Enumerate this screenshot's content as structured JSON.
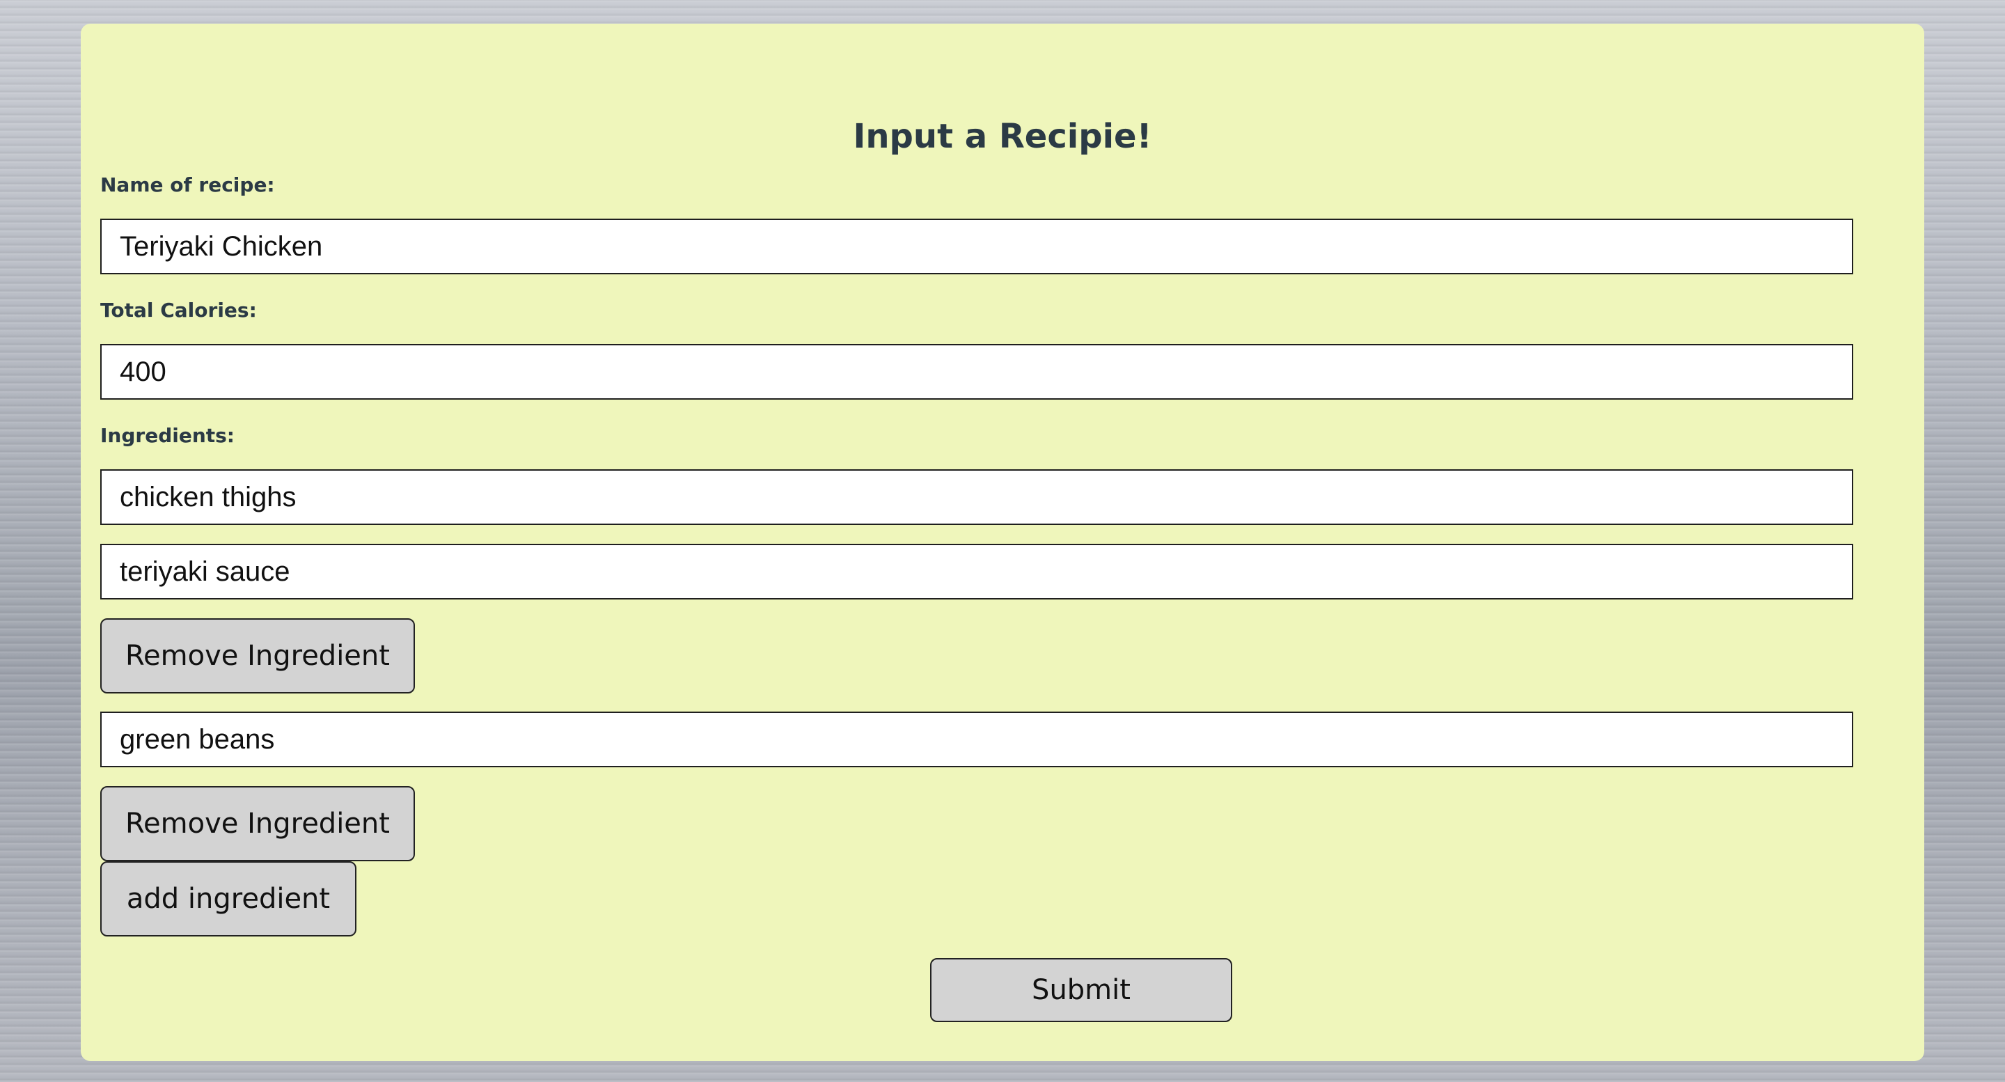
{
  "form": {
    "title": "Input a Recipie!",
    "name_label": "Name of recipe:",
    "name_value": "Teriyaki Chicken",
    "calories_label": "Total Calories:",
    "calories_value": "400",
    "ingredients_label": "Ingredients:",
    "ingredients": [
      {
        "value": "chicken thighs"
      },
      {
        "value": "teriyaki sauce",
        "remove_label": "Remove Ingredient"
      },
      {
        "value": "green beans",
        "remove_label": "Remove Ingredient"
      }
    ],
    "add_label": "add ingredient",
    "submit_label": "Submit"
  },
  "colors": {
    "card_background": "#eff6bb",
    "text": "#2b3a45",
    "button_background": "#d3d3d3"
  }
}
